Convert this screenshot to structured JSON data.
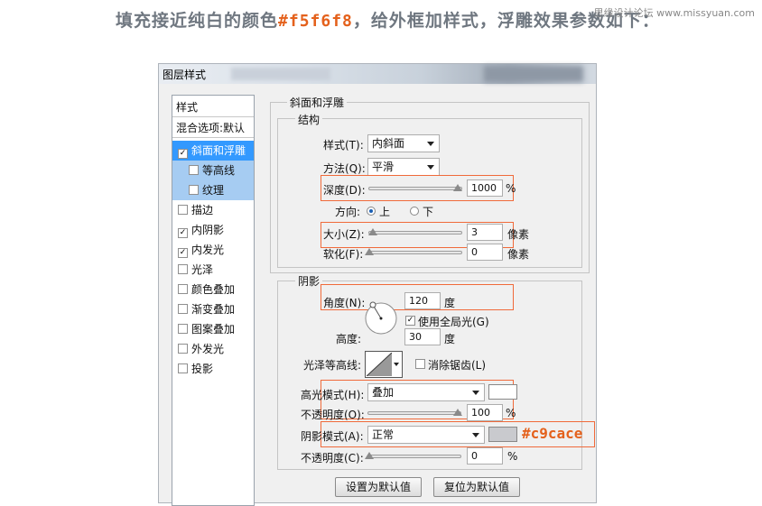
{
  "heading": {
    "prefix": "填充接近纯白的颜色",
    "color_value": "#f5f6f8",
    "suffix": "，给外框加样式，浮雕效果参数如下："
  },
  "watermark": "思缘设计论坛 www.missyuan.com",
  "dialog": {
    "title": "图层样式",
    "style_list": {
      "header": "样式",
      "blending": "混合选项:默认",
      "items": [
        {
          "label": "斜面和浮雕",
          "checked": true,
          "state": "selected"
        },
        {
          "label": "等高线",
          "checked": false,
          "state": "sub"
        },
        {
          "label": "纹理",
          "checked": false,
          "state": "sub"
        },
        {
          "label": "描边",
          "checked": false
        },
        {
          "label": "内阴影",
          "checked": true
        },
        {
          "label": "内发光",
          "checked": true
        },
        {
          "label": "光泽",
          "checked": false
        },
        {
          "label": "颜色叠加",
          "checked": false
        },
        {
          "label": "渐变叠加",
          "checked": false
        },
        {
          "label": "图案叠加",
          "checked": false
        },
        {
          "label": "外发光",
          "checked": false
        },
        {
          "label": "投影",
          "checked": false
        }
      ]
    },
    "bevel": {
      "section_title": "斜面和浮雕",
      "structure_title": "结构",
      "style_label": "样式(T):",
      "style_value": "内斜面",
      "technique_label": "方法(Q):",
      "technique_value": "平滑",
      "depth_label": "深度(D):",
      "depth_value": "1000",
      "depth_unit": "%",
      "depth_level": 1.0,
      "direction_label": "方向:",
      "direction_up": "上",
      "direction_down": "下",
      "direction_selected": "上",
      "size_label": "大小(Z):",
      "size_value": "3",
      "size_unit": "像素",
      "size_level": 0.02,
      "soften_label": "软化(F):",
      "soften_value": "0",
      "soften_unit": "像素",
      "soften_level": 0.0
    },
    "shading": {
      "section_title": "阴影",
      "angle_label": "角度(N):",
      "angle_value": "120",
      "angle_unit": "度",
      "global_light_label": "使用全局光(G)",
      "global_light_checked": true,
      "altitude_label": "高度:",
      "altitude_value": "30",
      "altitude_unit": "度",
      "gloss_contour_label": "光泽等高线:",
      "antialias_label": "消除锯齿(L)",
      "antialias_checked": false,
      "highlight_mode_label": "高光模式(H):",
      "highlight_mode_value": "叠加",
      "highlight_color": "#ffffff",
      "highlight_opacity_label": "不透明度(O):",
      "highlight_opacity_value": "100",
      "highlight_opacity_unit": "%",
      "highlight_opacity_level": 1.0,
      "shadow_mode_label": "阴影模式(A):",
      "shadow_mode_value": "正常",
      "shadow_color": "#c9cace",
      "shadow_color_annotation": "#c9cace",
      "shadow_opacity_label": "不透明度(C):",
      "shadow_opacity_value": "0",
      "shadow_opacity_unit": "%",
      "shadow_opacity_level": 0.0
    },
    "buttons": {
      "make_default": "设置为默认值",
      "reset_default": "复位为默认值"
    }
  },
  "colors": {
    "selection": "#3399ff",
    "sub_selection": "#a6ccf2",
    "highlight_box": "#f06a3a",
    "annotation": "#e4611c"
  }
}
